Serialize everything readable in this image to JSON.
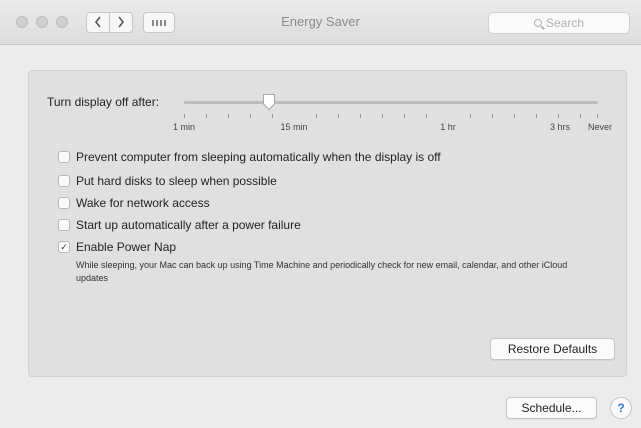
{
  "window": {
    "title": "Energy Saver",
    "search_placeholder": "Search"
  },
  "icons": {
    "back": "chevron-left-icon",
    "forward": "chevron-right-icon",
    "grid": "show-all-grid-icon",
    "search": "search-icon",
    "help": "help-icon"
  },
  "slider": {
    "label": "Turn display off after:",
    "tick_labels": [
      "1 min",
      "15 min",
      "1 hr",
      "3 hrs",
      "Never"
    ],
    "value": "15 min"
  },
  "options": [
    {
      "label": "Prevent computer from sleeping automatically when the display is off",
      "checked": false
    },
    {
      "label": "Put hard disks to sleep when possible",
      "checked": false
    },
    {
      "label": "Wake for network access",
      "checked": false
    },
    {
      "label": "Start up automatically after a power failure",
      "checked": false
    },
    {
      "label": "Enable Power Nap",
      "checked": true
    }
  ],
  "power_nap_description": "While sleeping, your Mac can back up using Time Machine and periodically check for new email, calendar, and other iCloud updates",
  "buttons": {
    "restore_defaults": "Restore Defaults",
    "schedule": "Schedule...",
    "help": "?"
  },
  "colors": {
    "accent": "#3a78d8",
    "background": "#ececec",
    "panel": "#e0e0e0"
  }
}
